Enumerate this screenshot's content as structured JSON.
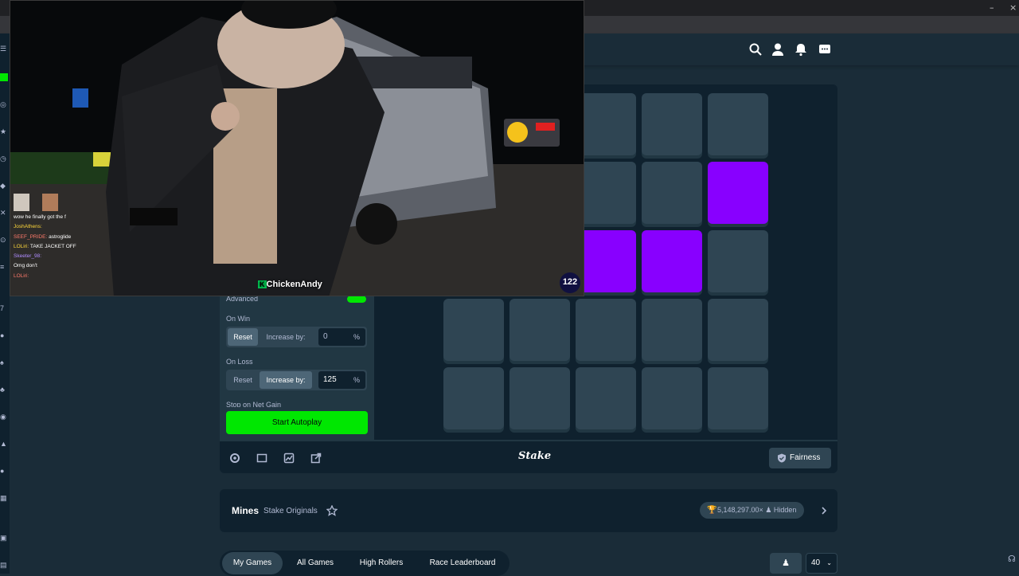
{
  "header": {
    "icons": [
      "search-icon",
      "user-icon",
      "bell-icon",
      "chat-icon"
    ]
  },
  "stream": {
    "streamer_tag": "ChickenAndy",
    "viewer_badge": "122",
    "chat": [
      {
        "user": "",
        "msg": "wow he finally got the f"
      },
      {
        "user": "JoshAthens",
        "msg": ""
      },
      {
        "user": "SEEF_PRIDE",
        "msg": "astroglide"
      },
      {
        "user": "LOLiri",
        "msg": "TAKE JACKET OFF"
      },
      {
        "user": "Skeeter_98",
        "msg": ""
      },
      {
        "user": "",
        "msg": "Omg don't"
      },
      {
        "user": "",
        "msg": ""
      },
      {
        "user": "LOLiri",
        "msg": ""
      }
    ]
  },
  "sidebar": {
    "advanced_label": "Advanced",
    "on_win_label": "On Win",
    "on_win": {
      "reset": "Reset",
      "increase": "Increase by:",
      "value": "0",
      "unit": "%"
    },
    "on_loss_label": "On Loss",
    "on_loss": {
      "reset": "Reset",
      "increase": "Increase by:",
      "value": "125",
      "unit": "%"
    },
    "stop_gain_label": "Stop on Net Gain",
    "start_label": "Start Autoplay"
  },
  "board": {
    "rows": [
      [
        "tile",
        "tile",
        "tile",
        "tile",
        "tile"
      ],
      [
        "tile",
        "tile",
        "tile",
        "tile",
        "gem"
      ],
      [
        "tile",
        "tile",
        "gem",
        "gem",
        "tile"
      ],
      [
        "tile",
        "tile",
        "tile",
        "tile",
        "tile"
      ],
      [
        "tile",
        "tile",
        "tile",
        "tile",
        "tile"
      ]
    ]
  },
  "toolbar": {
    "logo": "Stake",
    "fairness": "Fairness"
  },
  "info": {
    "title": "Mines",
    "subtitle": "Stake Originals",
    "multiplier": "5,148,297.00×",
    "hidden": "Hidden"
  },
  "tabs": [
    "My Games",
    "All Games",
    "High Rollers",
    "Race Leaderboard"
  ],
  "page_size": "40",
  "colors": {
    "accent_green": "#00e701",
    "gem_purple": "#8800ff",
    "bg": "#1a2c38"
  }
}
